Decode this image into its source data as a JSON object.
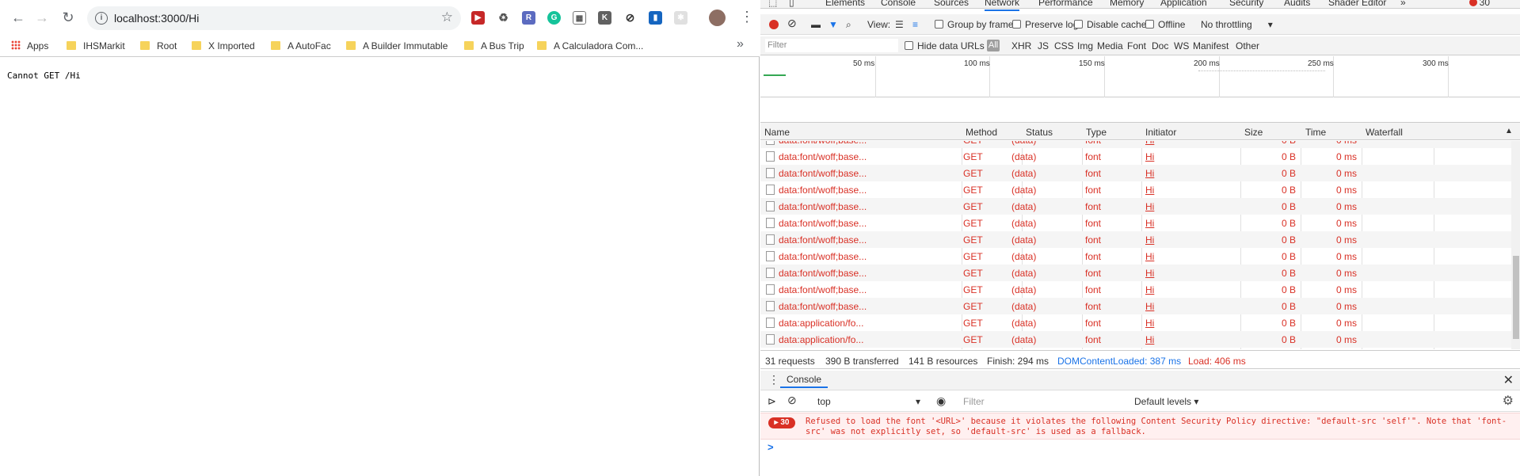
{
  "browser": {
    "url": "localhost:3000/Hi",
    "bookmarks": [
      "Apps",
      "IHSMarkit",
      "Root",
      "X Imported",
      "A AutoFac",
      "A Builder Immutable",
      "A Bus Trip",
      "A Calculadora Com..."
    ],
    "page_text": "Cannot GET /Hi"
  },
  "devtools": {
    "tabs": [
      "Elements",
      "Console",
      "Sources",
      "Network",
      "Performance",
      "Memory",
      "Application",
      "Security",
      "Audits",
      "Shader Editor"
    ],
    "error_count": "30",
    "toolbar": {
      "view_label": "View:",
      "group_by_frame": "Group by frame",
      "preserve_log": "Preserve log",
      "disable_cache": "Disable cache",
      "offline": "Offline",
      "throttling": "No throttling"
    },
    "filter": {
      "placeholder": "Filter",
      "hide_data_urls": "Hide data URLs",
      "types": [
        "All",
        "XHR",
        "JS",
        "CSS",
        "Img",
        "Media",
        "Font",
        "Doc",
        "WS",
        "Manifest",
        "Other"
      ]
    },
    "overview_ticks": [
      "50 ms",
      "100 ms",
      "150 ms",
      "200 ms",
      "250 ms",
      "300 ms"
    ],
    "columns": [
      "Name",
      "Method",
      "Status",
      "Type",
      "Initiator",
      "Size",
      "Time",
      "Waterfall"
    ],
    "rows": [
      {
        "name": "data:font/woff;base...",
        "method": "GET",
        "status": "(data)",
        "type": "font",
        "initiator": "Hi",
        "size": "0 B",
        "time": "0 ms"
      },
      {
        "name": "data:font/woff;base...",
        "method": "GET",
        "status": "(data)",
        "type": "font",
        "initiator": "Hi",
        "size": "0 B",
        "time": "0 ms"
      },
      {
        "name": "data:font/woff;base...",
        "method": "GET",
        "status": "(data)",
        "type": "font",
        "initiator": "Hi",
        "size": "0 B",
        "time": "0 ms"
      },
      {
        "name": "data:font/woff;base...",
        "method": "GET",
        "status": "(data)",
        "type": "font",
        "initiator": "Hi",
        "size": "0 B",
        "time": "0 ms"
      },
      {
        "name": "data:font/woff;base...",
        "method": "GET",
        "status": "(data)",
        "type": "font",
        "initiator": "Hi",
        "size": "0 B",
        "time": "0 ms"
      },
      {
        "name": "data:font/woff;base...",
        "method": "GET",
        "status": "(data)",
        "type": "font",
        "initiator": "Hi",
        "size": "0 B",
        "time": "0 ms"
      },
      {
        "name": "data:font/woff;base...",
        "method": "GET",
        "status": "(data)",
        "type": "font",
        "initiator": "Hi",
        "size": "0 B",
        "time": "0 ms"
      },
      {
        "name": "data:font/woff;base...",
        "method": "GET",
        "status": "(data)",
        "type": "font",
        "initiator": "Hi",
        "size": "0 B",
        "time": "0 ms"
      },
      {
        "name": "data:font/woff;base...",
        "method": "GET",
        "status": "(data)",
        "type": "font",
        "initiator": "Hi",
        "size": "0 B",
        "time": "0 ms"
      },
      {
        "name": "data:font/woff;base...",
        "method": "GET",
        "status": "(data)",
        "type": "font",
        "initiator": "Hi",
        "size": "0 B",
        "time": "0 ms"
      },
      {
        "name": "data:font/woff;base...",
        "method": "GET",
        "status": "(data)",
        "type": "font",
        "initiator": "Hi",
        "size": "0 B",
        "time": "0 ms"
      },
      {
        "name": "data:application/fo...",
        "method": "GET",
        "status": "(data)",
        "type": "font",
        "initiator": "Hi",
        "size": "0 B",
        "time": "0 ms"
      },
      {
        "name": "data:application/fo...",
        "method": "GET",
        "status": "(data)",
        "type": "font",
        "initiator": "Hi",
        "size": "0 B",
        "time": "0 ms"
      }
    ],
    "status_bar": {
      "requests": "31 requests",
      "transferred": "390 B transferred",
      "resources": "141 B resources",
      "finish": "Finish: 294 ms",
      "dom_loaded": "DOMContentLoaded: 387 ms",
      "load": "Load: 406 ms"
    },
    "console": {
      "tab": "Console",
      "context": "top",
      "filter_placeholder": "Filter",
      "levels": "Default levels",
      "error_badge": "30",
      "error_message": "Refused to load the font '<URL>' because it violates the following Content Security Policy directive: \"default-src 'self'\". Note that 'font-src' was not explicitly set, so 'default-src' is used as a fallback.",
      "prompt": ">"
    }
  },
  "colors": {
    "error": "#d93025",
    "accent": "#1a73e8"
  }
}
